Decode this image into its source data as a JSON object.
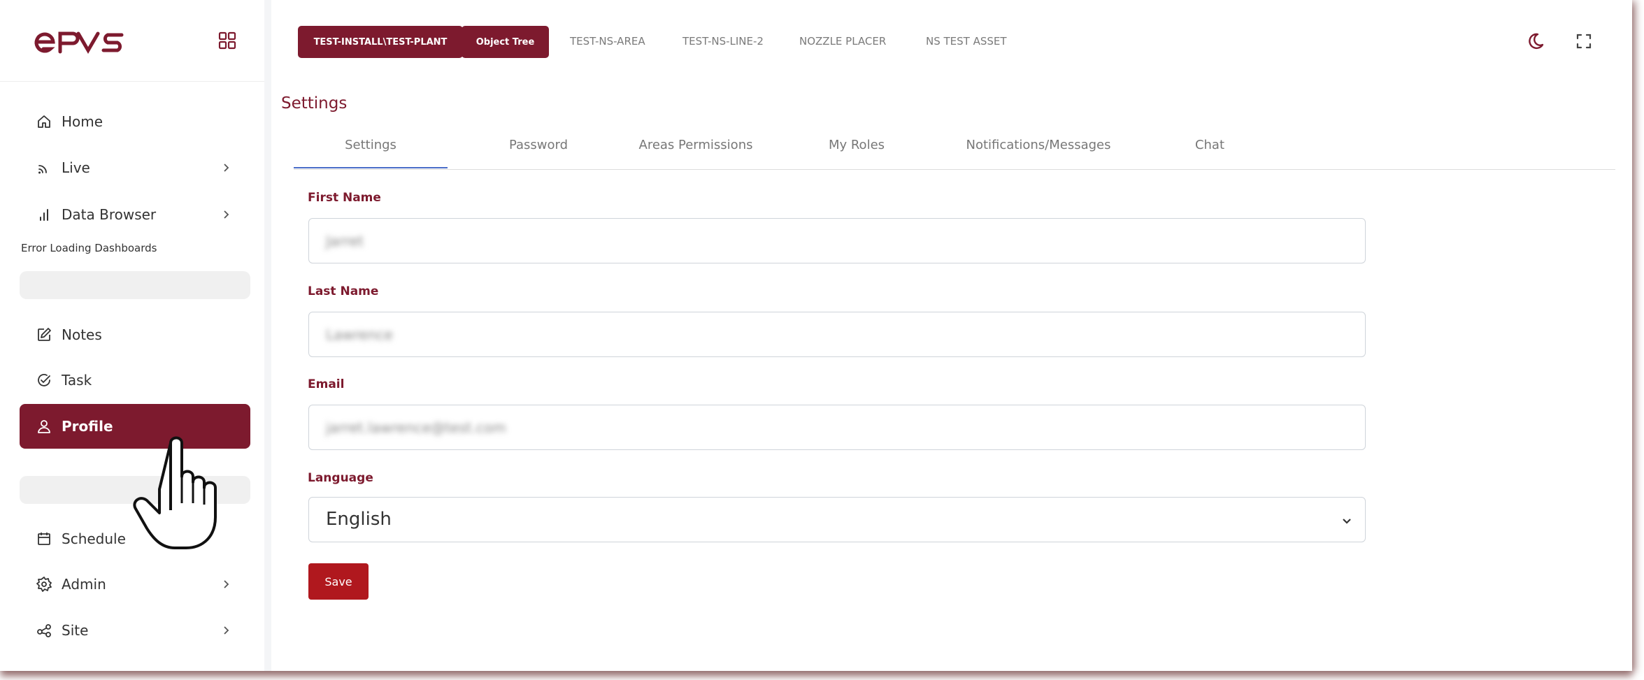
{
  "app": {
    "brand": "ePVS",
    "colors": {
      "accent": "#7d1a2e",
      "save": "#b0181e",
      "tab_indicator": "#4a6ec8"
    }
  },
  "sidebar": {
    "items": [
      {
        "label": "Home",
        "icon": "home-icon"
      },
      {
        "label": "Live",
        "icon": "live-icon"
      },
      {
        "label": "Data Browser",
        "icon": "bar-chart-icon"
      },
      {
        "label": "Notes",
        "icon": "edit-icon"
      },
      {
        "label": "Task",
        "icon": "check-circle-icon"
      },
      {
        "label": "Profile",
        "icon": "user-icon"
      },
      {
        "label": "Schedule",
        "icon": "calendar-icon"
      },
      {
        "label": "Admin",
        "icon": "gear-icon"
      },
      {
        "label": "Site",
        "icon": "share-icon"
      }
    ],
    "error_text": "Error Loading Dashboards"
  },
  "topbar": {
    "breadcrumbs": [
      {
        "label": "TEST-INSTALL\\TEST-PLANT",
        "style": "button"
      },
      {
        "label": "Object Tree",
        "style": "button"
      },
      {
        "label": "TEST-NS-AREA",
        "style": "link"
      },
      {
        "label": "TEST-NS-LINE-2",
        "style": "link"
      },
      {
        "label": "NOZZLE PLACER",
        "style": "link"
      },
      {
        "label": "NS TEST ASSET",
        "style": "link"
      }
    ]
  },
  "main": {
    "title": "Settings",
    "tabs": [
      "Settings",
      "Password",
      "Areas Permissions",
      "My Roles",
      "Notifications/Messages",
      "Chat"
    ],
    "active_tab": "Settings",
    "form": {
      "first_name_label": "First Name",
      "first_name_value": "Jarret",
      "last_name_label": "Last Name",
      "last_name_value": "Lawrence",
      "email_label": "Email",
      "email_value": "jarret.lawrence@test.com",
      "language_label": "Language",
      "language_value": "English",
      "save_label": "Save"
    }
  }
}
